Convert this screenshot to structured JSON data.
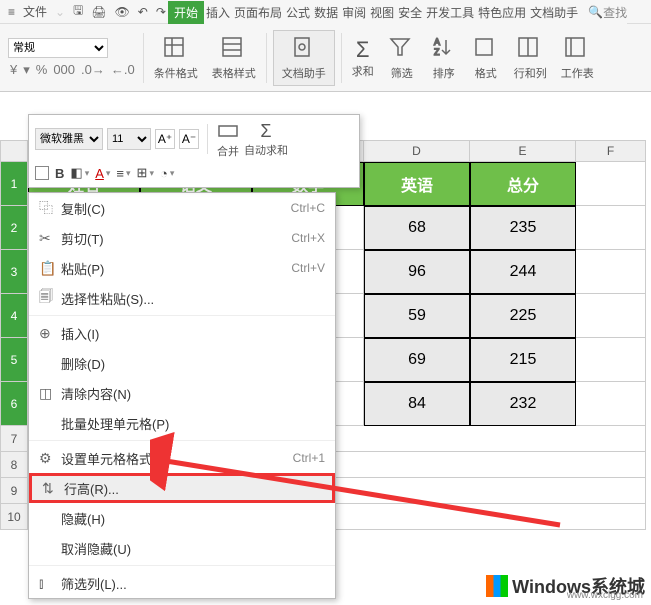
{
  "topbar": {
    "menu": "文件",
    "find_label": "查找"
  },
  "tabs": {
    "items": [
      "开始",
      "插入",
      "页面布局",
      "公式",
      "数据",
      "审阅",
      "视图",
      "安全",
      "开发工具",
      "特色应用",
      "文档助手"
    ],
    "active": 0
  },
  "ribbon": {
    "numfmt_sel": "常规",
    "groups": {
      "condfmt": "条件格式",
      "tblstyle": "表格样式",
      "dochelp": "文档助手",
      "sum": "求和",
      "filter": "筛选",
      "sort": "排序",
      "format": "格式",
      "rowcol": "行和列",
      "worksheet": "工作表"
    }
  },
  "mini": {
    "fontname": "微软雅黑",
    "fontsize": "11",
    "aplus": "A⁺",
    "aminus": "A⁻",
    "merge": "合并",
    "autosum": "自动求和",
    "bold": "B"
  },
  "context": {
    "copy": {
      "l": "复制(C)",
      "s": "Ctrl+C"
    },
    "cut": {
      "l": "剪切(T)",
      "s": "Ctrl+X"
    },
    "paste": {
      "l": "粘贴(P)",
      "s": "Ctrl+V"
    },
    "pastesp": {
      "l": "选择性粘贴(S)..."
    },
    "insert": {
      "l": "插入(I)"
    },
    "delete": {
      "l": "删除(D)"
    },
    "clear": {
      "l": "清除内容(N)"
    },
    "batch": {
      "l": "批量处理单元格(P)"
    },
    "cellfmt": {
      "l": "设置单元格格式(F)...",
      "s": "Ctrl+1"
    },
    "rowh": {
      "l": "行高(R)..."
    },
    "hide": {
      "l": "隐藏(H)"
    },
    "unhide": {
      "l": "取消隐藏(U)"
    },
    "filtercol": {
      "l": "筛选列(L)..."
    }
  },
  "cols": [
    "D",
    "E",
    "F"
  ],
  "headers": {
    "name": "姓名",
    "chn": "语文",
    "math": "数学",
    "eng": "英语",
    "total": "总分"
  },
  "data": [
    {
      "eng": "68",
      "total": "235"
    },
    {
      "eng": "96",
      "total": "244"
    },
    {
      "eng": "59",
      "total": "225"
    },
    {
      "eng": "69",
      "total": "215"
    },
    {
      "eng": "84",
      "total": "232"
    }
  ],
  "rows": [
    "1",
    "2",
    "3",
    "4",
    "5",
    "6",
    "7",
    "8",
    "9",
    "10"
  ],
  "watermark": {
    "title": "Windows系统城",
    "url": "www.wxclgg.com"
  }
}
